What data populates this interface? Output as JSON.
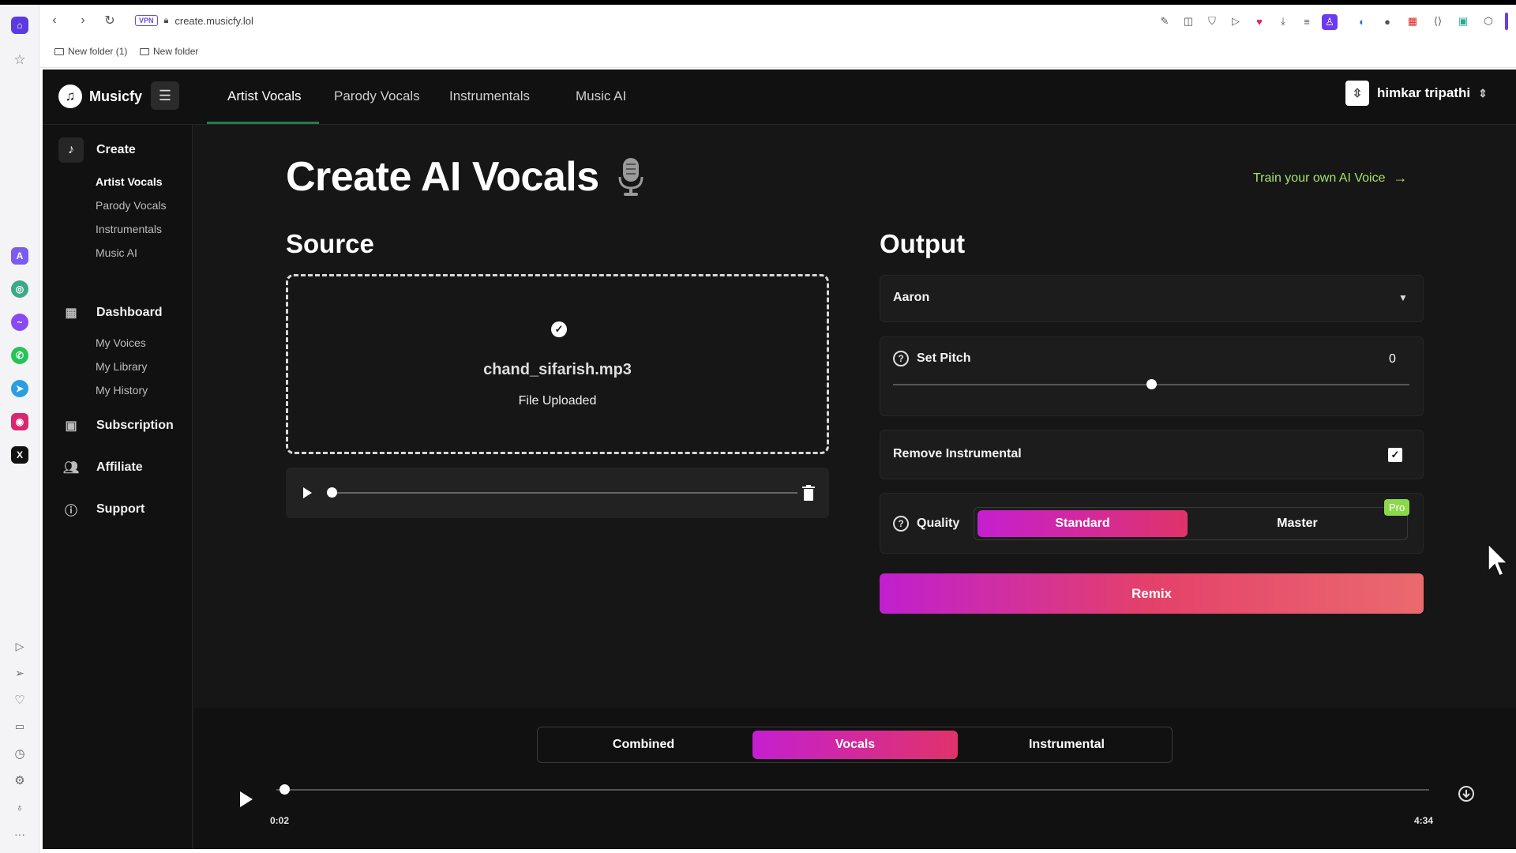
{
  "browser": {
    "url": "create.musicfy.lol",
    "vpn_label": "VPN",
    "bookmarks": [
      "New folder (1)",
      "New folder"
    ]
  },
  "app": {
    "logo": "Musicfy",
    "tabs": [
      {
        "label": "Artist Vocals",
        "active": true
      },
      {
        "label": "Parody Vocals",
        "active": false
      },
      {
        "label": "Instrumentals",
        "active": false
      },
      {
        "label": "Music AI",
        "active": false
      }
    ],
    "user": {
      "name": "himkar tripathi"
    }
  },
  "sidebar": {
    "create": {
      "label": "Create",
      "items": [
        "Artist Vocals",
        "Parody Vocals",
        "Instrumentals",
        "Music AI"
      ]
    },
    "dashboard": {
      "label": "Dashboard",
      "items": [
        "My Voices",
        "My Library",
        "My History"
      ]
    },
    "subscription": "Subscription",
    "affiliate": "Affiliate",
    "support": "Support"
  },
  "main": {
    "title": "Create AI Vocals",
    "train_link": "Train your own AI Voice",
    "source": {
      "title": "Source",
      "file_name": "chand_sifarish.mp3",
      "status": "File Uploaded"
    },
    "output": {
      "title": "Output",
      "voice": "Aaron",
      "pitch_label": "Set Pitch",
      "pitch_value": "0",
      "pitch_fraction": 0.5,
      "remove_instrumental_label": "Remove Instrumental",
      "remove_instrumental_checked": true,
      "quality_label": "Quality",
      "quality_options": [
        "Standard",
        "Master"
      ],
      "quality_selected": "Standard",
      "pro_badge": "Pro",
      "remix_label": "Remix"
    }
  },
  "player": {
    "modes": [
      "Combined",
      "Vocals",
      "Instrumental"
    ],
    "selected_mode": "Vocals",
    "current_time": "0:02",
    "duration": "4:34",
    "progress_fraction": 0.007
  },
  "colors": {
    "accent_start": "#c51fd0",
    "accent_end": "#e0336a",
    "link_green": "#a7e06a",
    "pro_green": "#8bd94b",
    "background": "#161616"
  }
}
